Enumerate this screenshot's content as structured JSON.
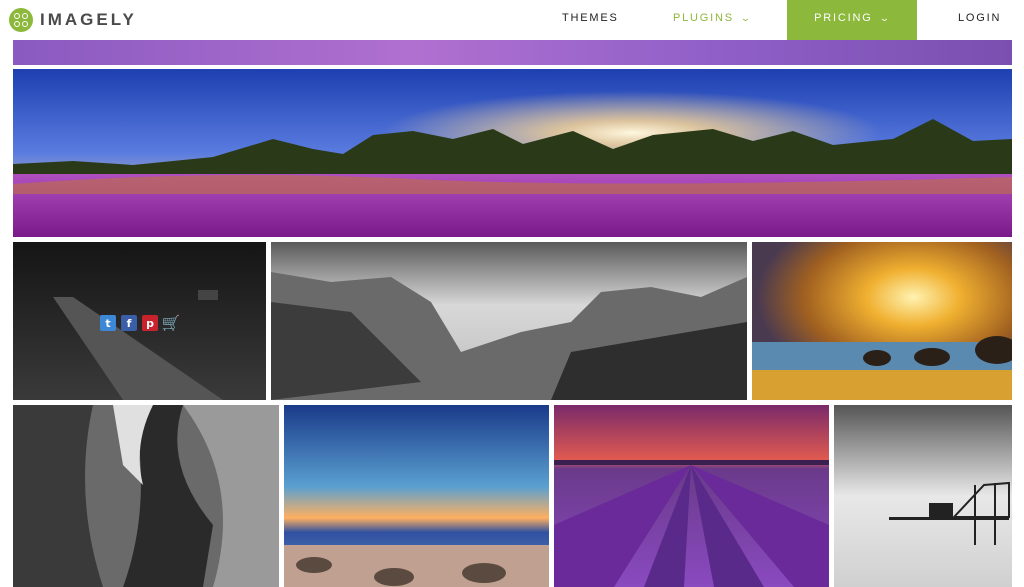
{
  "header": {
    "logo_text": "IMAGELY",
    "nav": {
      "themes": "THEMES",
      "plugins": "PLUGINS",
      "pricing": "PRICING",
      "login": "LOGIN"
    }
  },
  "gallery": {
    "tiles": [
      {
        "id": "lavender-strip",
        "desc": "lavender field"
      },
      {
        "id": "lavender-sunset-panorama",
        "desc": "panorama of purple flowers at sunset"
      },
      {
        "id": "pier-bw",
        "desc": "black and white pier on lake"
      },
      {
        "id": "yosemite-bw",
        "desc": "black and white mountain valley"
      },
      {
        "id": "sunset-rocks",
        "desc": "golden sky over sea rocks"
      },
      {
        "id": "canyon-bw",
        "desc": "black and white slot canyon"
      },
      {
        "id": "ocean-sunset",
        "desc": "ocean sunrise with rocks"
      },
      {
        "id": "lavender-rows",
        "desc": "lavender rows at dusk"
      },
      {
        "id": "pier-fog-bw",
        "desc": "black and white pier in fog"
      }
    ],
    "share_icons": [
      "twitter-icon",
      "facebook-icon",
      "pinterest-icon",
      "cart-icon"
    ]
  },
  "colors": {
    "brand": "#8cb83c"
  }
}
